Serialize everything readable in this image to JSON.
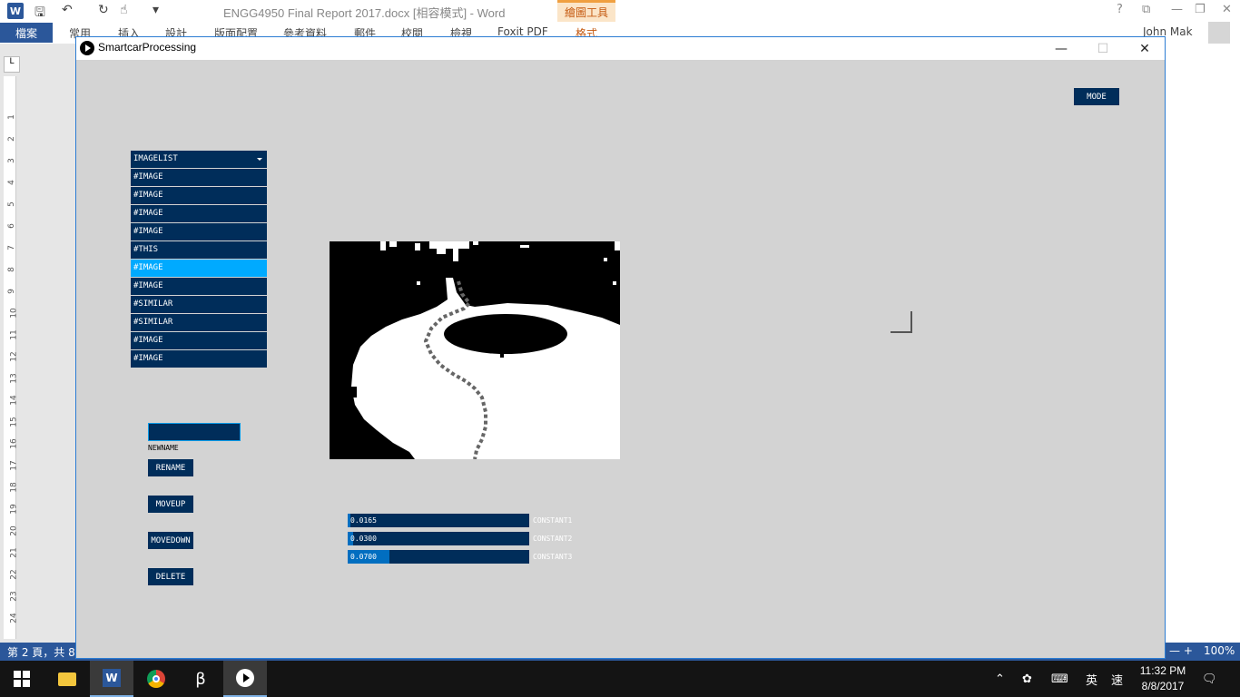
{
  "word": {
    "doc_title": "ENGG4950 Final Report 2017.docx [相容模式] - Word",
    "app_icon_letter": "W",
    "contextual_tab_group": "繪圖工具",
    "file_tab": "檔案",
    "ribbon_tabs": [
      "常用",
      "插入",
      "設計",
      "版面配置",
      "參考資料",
      "郵件",
      "校閱",
      "檢視",
      "Foxit PDF",
      "格式"
    ],
    "user_name": "John Mak",
    "help_glyph": "?",
    "status_page": "第 2 頁，共 8",
    "zoom_percent": "100%",
    "ruler_numbers": [
      "1",
      "2",
      "3",
      "4",
      "5",
      "6",
      "7",
      "8",
      "9",
      "10",
      "11",
      "12",
      "13",
      "14",
      "15",
      "16",
      "17",
      "18",
      "19",
      "20",
      "21",
      "22",
      "23",
      "24"
    ],
    "ruler_corner": "L"
  },
  "window": {
    "title": "SmartcarProcessing",
    "minimize": "—",
    "maximize": "☐",
    "close": "✕"
  },
  "app": {
    "mode_label": "MODE",
    "imagelist": {
      "header": "IMAGELIST",
      "items": [
        "#IMAGE",
        "#IMAGE",
        "#IMAGE",
        "#IMAGE",
        "#THIS",
        "#IMAGE",
        "#IMAGE",
        "#SIMILAR",
        "#SIMILAR",
        "#IMAGE",
        "#IMAGE"
      ],
      "active_index": 5
    },
    "newname": {
      "value": "",
      "label": "NEWNAME"
    },
    "buttons": {
      "rename": "RENAME",
      "moveup": "MOVEUP",
      "movedown": "MOVEDOWN",
      "delete": "DELETE"
    },
    "sliders": [
      {
        "label": "CONSTANT1",
        "value_text": "0.0165",
        "fraction": 0.0165
      },
      {
        "label": "CONSTANT2",
        "value_text": "0.0300",
        "fraction": 0.03
      },
      {
        "label": "CONSTANT3",
        "value_text": "0.0700",
        "fraction": 0.23
      }
    ]
  },
  "taskbar": {
    "clock_time": "11:32 PM",
    "clock_date": "8/8/2017",
    "ime_lang": "英",
    "ime_mode": "速"
  },
  "colors": {
    "control_bg": "#002d5a",
    "control_active": "#00aaff",
    "slider_fill": "#016ec0",
    "canvas_bg": "#d3d3d3",
    "word_accent": "#2b579a"
  }
}
